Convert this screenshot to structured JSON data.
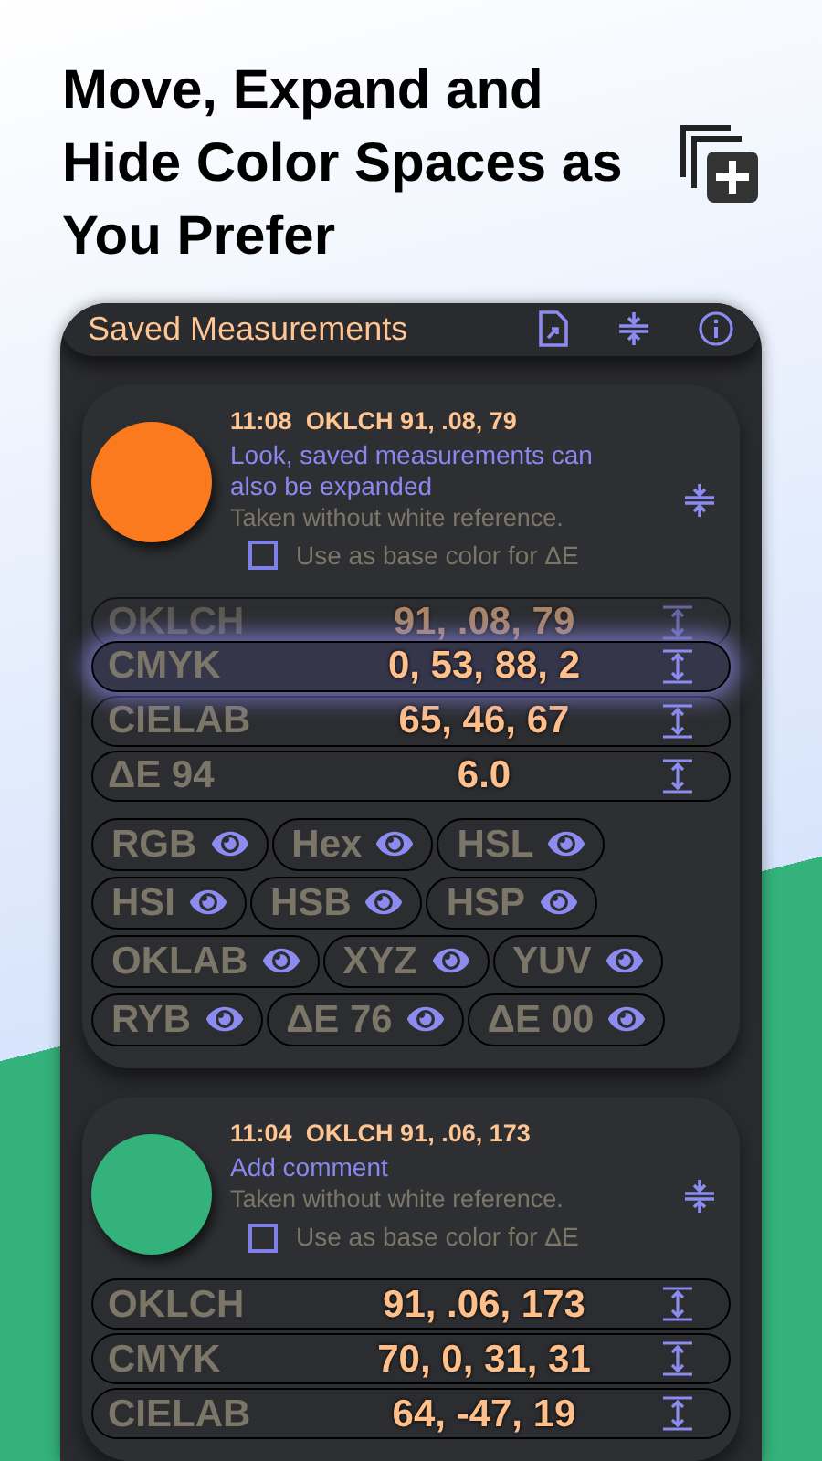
{
  "headline": "Move, Expand and Hide Color Spaces as You Prefer",
  "panel": {
    "title": "Saved Measurements"
  },
  "measurements": [
    {
      "time": "11:08",
      "reading": "OKLCH 91, .08, 79",
      "color": "#fb7a1e",
      "comment": "Look, saved measurements can also be expanded",
      "note": "Taken without white reference.",
      "base_label": "Use as base color for ΔE",
      "checked": false,
      "rows": [
        {
          "name": "OKLCH",
          "value": "91, .08, 79",
          "dragging": false,
          "dimmed": true
        },
        {
          "name": "CMYK",
          "value": "0, 53, 88, 2",
          "dragging": true,
          "dimmed": false
        },
        {
          "name": "CIELAB",
          "value": "65, 46, 67",
          "dragging": false,
          "dimmed": false
        },
        {
          "name": "ΔE 94",
          "value": "6.0",
          "dragging": false,
          "dimmed": false
        }
      ],
      "hidden": [
        "RGB",
        "Hex",
        "HSL",
        "HSI",
        "HSB",
        "HSP",
        "OKLAB",
        "XYZ",
        "YUV",
        "RYB",
        "ΔE 76",
        "ΔE 00"
      ]
    },
    {
      "time": "11:04",
      "reading": "OKLCH 91, .06, 173",
      "color": "#33b27b",
      "comment": "Add comment",
      "note": "Taken without white reference.",
      "base_label": "Use as base color for ΔE",
      "checked": false,
      "rows": [
        {
          "name": "OKLCH",
          "value": "91, .06, 173",
          "dragging": false,
          "dimmed": false
        },
        {
          "name": "CMYK",
          "value": "70, 0, 31, 31",
          "dragging": false,
          "dimmed": false
        },
        {
          "name": "CIELAB",
          "value": "64, -47, 19",
          "dragging": false,
          "dimmed": false
        }
      ]
    }
  ]
}
